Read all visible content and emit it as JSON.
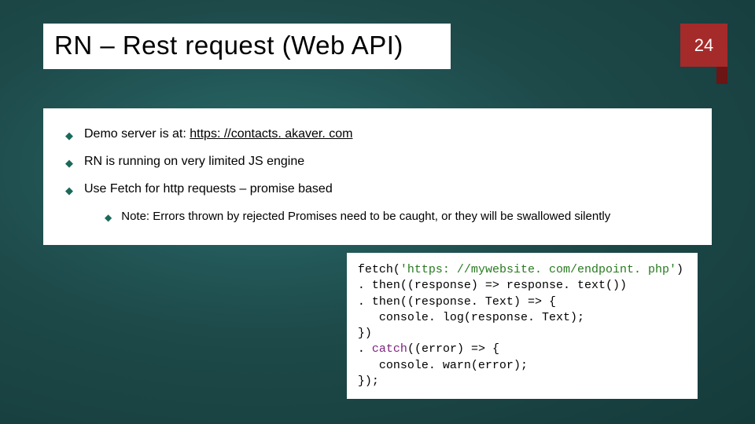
{
  "header": {
    "title": "RN – Rest request (Web API)",
    "page_number": "24"
  },
  "bullets": {
    "b1_prefix": "Demo server is at: ",
    "b1_link": "https: //contacts. akaver. com",
    "b2": "RN is running on very limited JS engine",
    "b3": "Use Fetch for http requests – promise based",
    "b3_sub": "Note: Errors thrown by rejected Promises need to be caught, or they will be swallowed silently"
  },
  "code": {
    "l1a": "fetch(",
    "l1b": "'https: //mywebsite. com/endpoint. php'",
    "l1c": ")",
    "l2": ". then((response) => response. text())",
    "l3": ". then((response. Text) => {",
    "l4": "   console. log(response. Text);",
    "l5": "})",
    "l6a": ". ",
    "l6b": "catch",
    "l6c": "((error) => {",
    "l7": "   console. warn(error);",
    "l8": "});"
  }
}
